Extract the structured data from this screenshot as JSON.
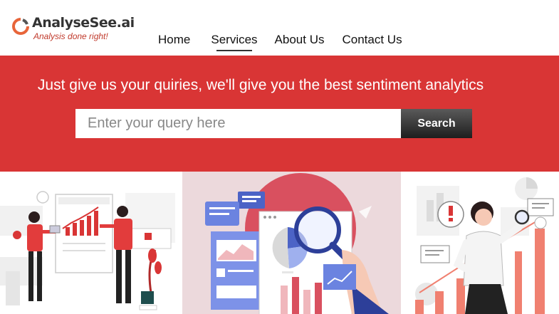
{
  "brand": {
    "name": "AnalyseSee.ai",
    "tagline": "Analysis done right!",
    "accent_color": "#d93535"
  },
  "nav": {
    "items": [
      {
        "label": "Home",
        "active": false
      },
      {
        "label": "Services",
        "active": true
      },
      {
        "label": "About Us",
        "active": false
      },
      {
        "label": "Contact Us",
        "active": false
      }
    ]
  },
  "hero": {
    "headline": "Just give us your quiries, we'll give you the best sentiment analytics",
    "search": {
      "placeholder": "Enter your query here",
      "value": "",
      "button_label": "Search"
    }
  },
  "illustrations": [
    {
      "icon": "presentation-chart-illustration"
    },
    {
      "icon": "data-analysis-magnifier-illustration"
    },
    {
      "icon": "business-analyst-illustration"
    }
  ]
}
